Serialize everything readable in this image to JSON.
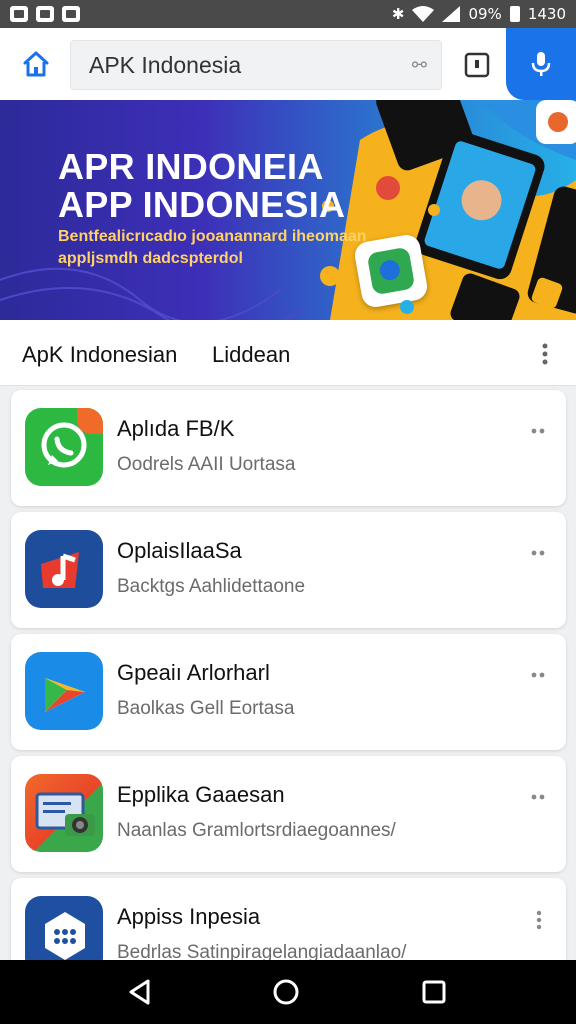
{
  "status_bar": {
    "battery_percent_text": "09%",
    "time": "1430"
  },
  "search": {
    "value": "APK Indonesia",
    "aux_glyph": "⚯"
  },
  "banner": {
    "line1": "APR INDONEIA",
    "line2": "APP INDONESIA",
    "sub1": "Bentfealicrıcadıo jooanannard iheomaan",
    "sub2": "appljsmdh dadcspterdol"
  },
  "list_header": {
    "title": "ApK Indonesian",
    "tab": "Liddean"
  },
  "apps": [
    {
      "name": "Aplıda FB/K",
      "desc": "Oodrels AAII Uortasa",
      "icon": "whatsapp-like-icon"
    },
    {
      "name": "OplaisIlaaSa",
      "desc": "Backtgs Aahlidettaone",
      "icon": "music-like-icon"
    },
    {
      "name": "Gpeaiı Arlorharl",
      "desc": "Baolkas Gell Eortasa",
      "icon": "play-like-icon"
    },
    {
      "name": "Epplika Gaaesan",
      "desc": "Naanlas Gramlortsrdiaegoannes/",
      "icon": "camera-like-icon"
    },
    {
      "name": "Appiss Inpesia",
      "desc": "Bedrlas Satinpiragelangiadaanlao/",
      "icon": "grid-app-icon"
    }
  ],
  "colors": {
    "accent": "#1a73e8",
    "status_bar": "#4a4a4a",
    "banner_start": "#2d2a9a",
    "banner_end": "#26b0e8",
    "banner_sub": "#ffd166"
  }
}
